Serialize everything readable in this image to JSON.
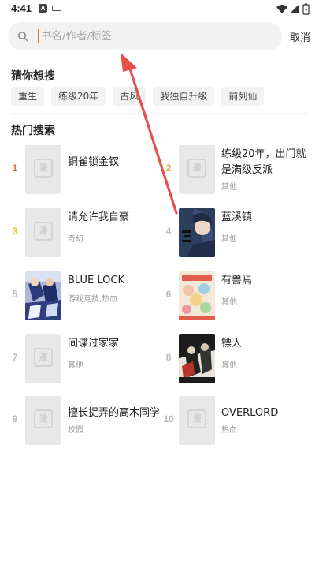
{
  "status": {
    "time": "4:41",
    "notif": "A"
  },
  "search": {
    "placeholder": "书名/作者/标签",
    "cancel_label": "取消"
  },
  "guess": {
    "title": "猜你想搜",
    "chips": [
      "重生",
      "练级20年",
      "古风",
      "我独自升级",
      "前列仙"
    ]
  },
  "hot": {
    "title": "热门搜索",
    "rank_colors": {
      "1": "#e06c3c",
      "2": "#e8a52b",
      "3": "#e8c12b",
      "other": "#bbbbbb"
    },
    "items": [
      {
        "rank": "1",
        "title": "铜雀锁金钗",
        "tag": ""
      },
      {
        "rank": "2",
        "title": "练级20年，出门就是满级反派",
        "tag": "其他"
      },
      {
        "rank": "3",
        "title": "请允许我自豪",
        "tag": "奇幻"
      },
      {
        "rank": "4",
        "title": "蓝溪镇",
        "tag": "其他"
      },
      {
        "rank": "5",
        "title": "BLUE LOCK",
        "tag": "游戏竞技,热血"
      },
      {
        "rank": "6",
        "title": "有兽焉",
        "tag": "其他"
      },
      {
        "rank": "7",
        "title": "间谍过家家",
        "tag": "其他"
      },
      {
        "rank": "8",
        "title": "镖人",
        "tag": "其他"
      },
      {
        "rank": "9",
        "title": "擅长捉弄的高木同学",
        "tag": "校园"
      },
      {
        "rank": "10",
        "title": "OVERLORD",
        "tag": "热血"
      }
    ],
    "placeholder_glyph": "漫"
  },
  "annotation": {
    "arrow_color": "#e8504a"
  }
}
